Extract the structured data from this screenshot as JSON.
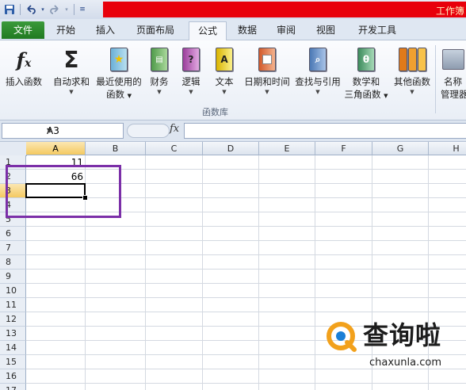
{
  "window": {
    "title": "工作簿",
    "accent_red": "#e8000b"
  },
  "qat": {
    "save_icon": "save-icon",
    "undo_icon": "undo-icon",
    "redo_icon": "redo-icon",
    "customize_icon": "customize-icon"
  },
  "tabs": [
    {
      "label": "文件"
    },
    {
      "label": "开始"
    },
    {
      "label": "插入"
    },
    {
      "label": "页面布局"
    },
    {
      "label": "公式",
      "active": true
    },
    {
      "label": "数据"
    },
    {
      "label": "审阅"
    },
    {
      "label": "视图"
    },
    {
      "label": "开发工具"
    }
  ],
  "ribbon": {
    "insert_function": {
      "label": "插入函数",
      "icon": "fx-icon"
    },
    "autosum": {
      "label": "自动求和",
      "icon": "sigma-icon"
    },
    "recent": {
      "label": "最近使用的",
      "label2": "函数",
      "icon": "star-book-icon"
    },
    "financial": {
      "label": "财务",
      "icon": "financial-book-icon"
    },
    "logical": {
      "label": "逻辑",
      "icon": "question-book-icon",
      "glyph": "?"
    },
    "text": {
      "label": "文本",
      "icon": "text-book-icon",
      "glyph": "A"
    },
    "datetime": {
      "label": "日期和时间",
      "icon": "calendar-book-icon"
    },
    "lookup": {
      "label": "查找与引用",
      "icon": "magnifier-book-icon"
    },
    "math": {
      "label": "数学和",
      "label2": "三角函数",
      "icon": "theta-book-icon",
      "glyph": "θ"
    },
    "more": {
      "label": "其他函数",
      "icon": "more-books-icon"
    },
    "name_manager": {
      "label": "名称",
      "label2": "管理器",
      "icon": "name-manager-icon"
    },
    "group_label": "函数库"
  },
  "formula_bar": {
    "name_box": "A3",
    "fx": "fx",
    "formula": ""
  },
  "grid": {
    "columns": [
      "A",
      "B",
      "C",
      "D",
      "E",
      "F",
      "G",
      "H"
    ],
    "rows": [
      "1",
      "2",
      "3",
      "4",
      "5",
      "6",
      "7",
      "8",
      "9",
      "10",
      "11",
      "12",
      "13",
      "14",
      "15",
      "16",
      "17"
    ],
    "cells": {
      "A1": "11",
      "A2": "66"
    },
    "selected_column": "A",
    "selected_row": "3",
    "annotation_color": "#7b2fa8"
  },
  "watermark": {
    "title": "查询啦",
    "url": "chaxunla.com"
  }
}
